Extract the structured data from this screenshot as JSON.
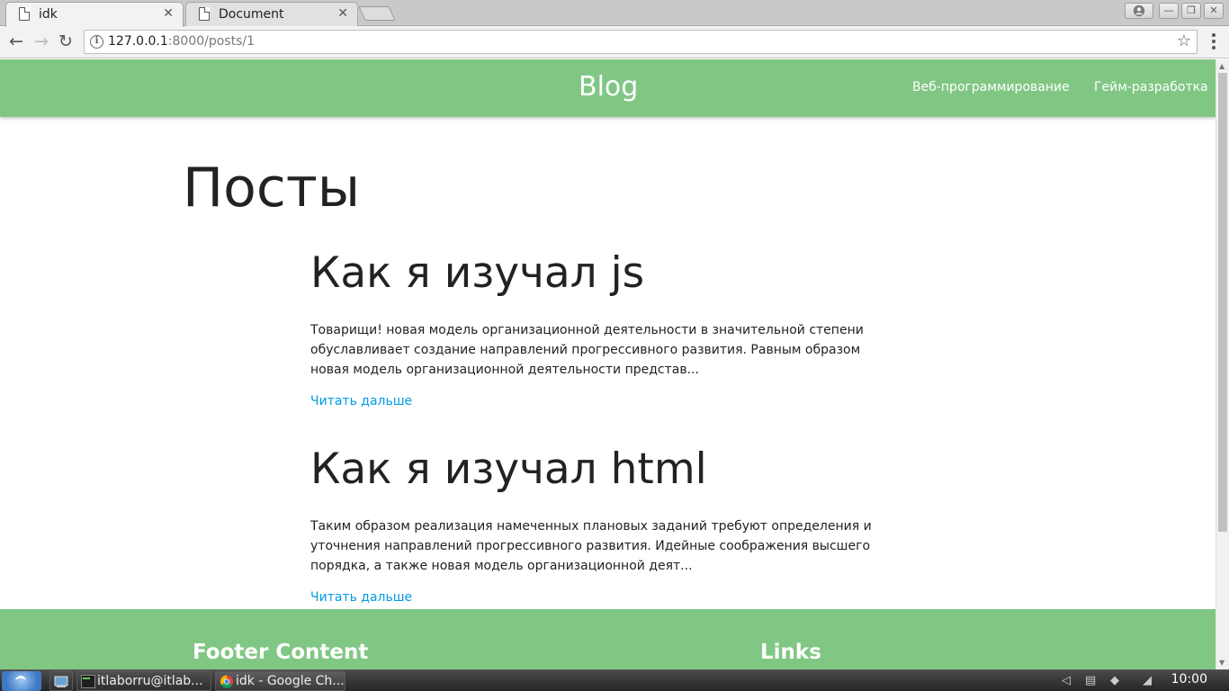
{
  "browser": {
    "tabs": [
      {
        "title": "idk",
        "close": "✕"
      },
      {
        "title": "Document",
        "close": "✕"
      }
    ],
    "url_host": "127.0.0.1",
    "url_path": ":8000/posts/1",
    "info_glyph": "i",
    "star_glyph": "☆",
    "back_glyph": "←",
    "forward_glyph": "→",
    "reload_glyph": "↻",
    "window_buttons": {
      "minimize": "—",
      "maximize": "❐",
      "close": "✕"
    }
  },
  "site": {
    "brand": "Blog",
    "nav_links": [
      "Веб-программирование",
      "Гейм-разработка"
    ],
    "page_title": "Посты",
    "posts": [
      {
        "title": "Как я изучал js",
        "excerpt": "Товарищи! новая модель организационной деятельности в значительной степени обуславливает создание направлений прогрессивного развития. Равным образом новая модель организационной деятельности представ...",
        "read_more": "Читать дальше"
      },
      {
        "title": "Как я изучал html",
        "excerpt": "Таким образом реализация намеченных плановых заданий требуют определения и уточнения направлений прогрессивного развития. Идейные соображения высшего порядка, а также новая модель организационной деят...",
        "read_more": "Читать дальше"
      }
    ],
    "footer": {
      "content_heading": "Footer Content",
      "links_heading": "Links"
    },
    "colors": {
      "primary": "#81c784",
      "link": "#039be5"
    }
  },
  "taskbar": {
    "tasks": [
      "itlaborru@itlab...",
      "idk - Google Ch..."
    ],
    "clock": "10:00"
  }
}
